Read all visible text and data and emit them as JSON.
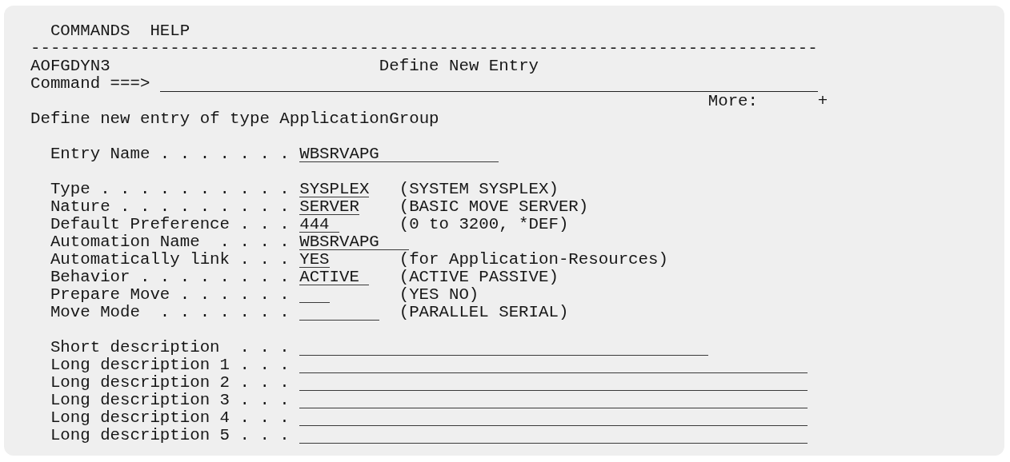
{
  "menu": [
    {
      "label": "COMMANDS"
    },
    {
      "label": "HELP"
    }
  ],
  "separator": "-------------------------------------------------------------------------------",
  "panel_id": "AOFGDYN3",
  "title": "Define New Entry",
  "command": {
    "label": "Command ===>"
  },
  "more": {
    "label": "More:",
    "indicator": "+"
  },
  "intro": "Define new entry of type ApplicationGroup",
  "fields": [
    {
      "label": "Entry Name . . . . . . .",
      "value": "WBSRVAPG"
    },
    {
      "label": "Type . . . . . . . . . .",
      "value": "SYSPLEX",
      "hint": "(SYSTEM SYSPLEX)"
    },
    {
      "label": "Nature . . . . . . . . .",
      "value": "SERVER",
      "hint": "(BASIC MOVE SERVER)"
    },
    {
      "label": "Default Preference . . .",
      "value": "444",
      "hint": "(0 to 3200, *DEF)"
    },
    {
      "label": "Automation Name  . . . .",
      "value": "WBSRVAPG"
    },
    {
      "label": "Automatically link . . .",
      "value": "YES",
      "hint": "(for Application-Resources)"
    },
    {
      "label": "Behavior . . . . . . . .",
      "value": "ACTIVE",
      "hint": "(ACTIVE PASSIVE)"
    },
    {
      "label": "Prepare Move . . . . . .",
      "hint": "(YES NO)"
    },
    {
      "label": "Move Mode  . . . . . . .",
      "hint": "(PARALLEL SERIAL)"
    }
  ],
  "descriptions": [
    {
      "label": "Short description  . . ."
    },
    {
      "label": "Long description 1 . . ."
    },
    {
      "label": "Long description 2 . . ."
    },
    {
      "label": "Long description 3 . . ."
    },
    {
      "label": "Long description 4 . . ."
    },
    {
      "label": "Long description 5 . . ."
    }
  ]
}
